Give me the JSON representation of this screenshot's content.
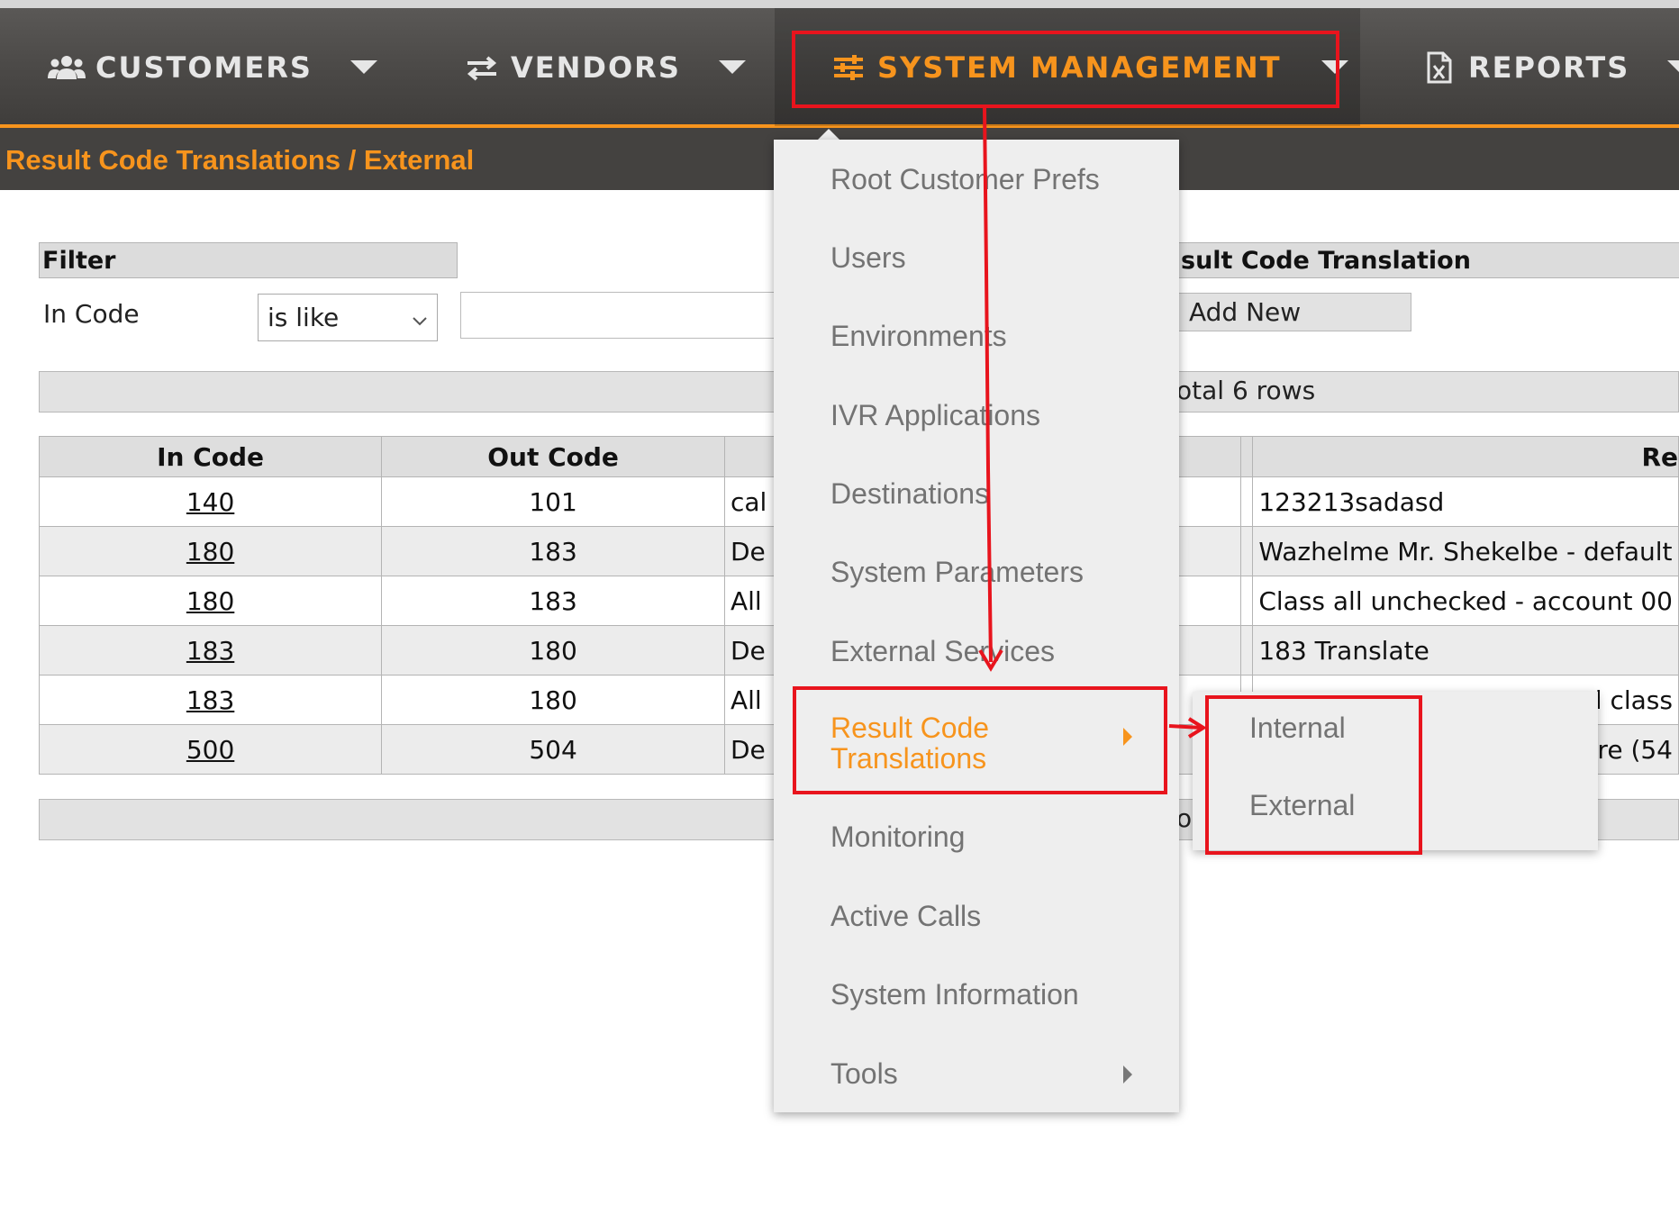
{
  "nav": {
    "items": [
      {
        "label": "CUSTOMERS",
        "icon": "users-icon"
      },
      {
        "label": "VENDORS",
        "icon": "swap-arrows-icon"
      },
      {
        "label": "SYSTEM MANAGEMENT",
        "icon": "sliders-icon"
      },
      {
        "label": "REPORTS",
        "icon": "excel-file-icon"
      }
    ]
  },
  "page": {
    "title": "Result Code Translations / External"
  },
  "filter": {
    "header": "Filter",
    "field_label": "In Code",
    "operator": "is like",
    "value": ""
  },
  "translation_panel": {
    "header": "sult Code Translation",
    "add_new": "Add New"
  },
  "pager": {
    "total_text": "otal 6 rows",
    "bottom_text": "o"
  },
  "table": {
    "headers": [
      "In Code",
      "Out Code",
      "",
      "",
      "Re"
    ],
    "rows": [
      {
        "in_code": "140",
        "out_code": "101",
        "desc": "cal",
        "remark": "123213sadasd"
      },
      {
        "in_code": "180",
        "out_code": "183",
        "desc": "De",
        "remark": "Wazhelme Mr. Shekelbe - default"
      },
      {
        "in_code": "180",
        "out_code": "183",
        "desc": "All",
        "remark": "Class all unchecked - account 00"
      },
      {
        "in_code": "183",
        "out_code": "180",
        "desc": "De",
        "remark": "183 Translate"
      },
      {
        "in_code": "183",
        "out_code": "180",
        "desc": "All",
        "remark": "ed class"
      },
      {
        "in_code": "500",
        "out_code": "504",
        "desc": "De",
        "remark": "ure (54"
      }
    ]
  },
  "menu": {
    "items": [
      "Root Customer Prefs",
      "Users",
      "Environments",
      "IVR Applications",
      "Destinations",
      "System Parameters",
      "External Services",
      "Result Code Translations",
      "Monitoring",
      "Active Calls",
      "System Information",
      "Tools"
    ],
    "result_code_line1": "Result Code",
    "result_code_line2": "Translations"
  },
  "submenu": {
    "items": [
      "Internal",
      "External"
    ]
  },
  "colors": {
    "accent": "#f7941d",
    "annotation": "#e8141d",
    "nav_bg": "#4a4846"
  }
}
